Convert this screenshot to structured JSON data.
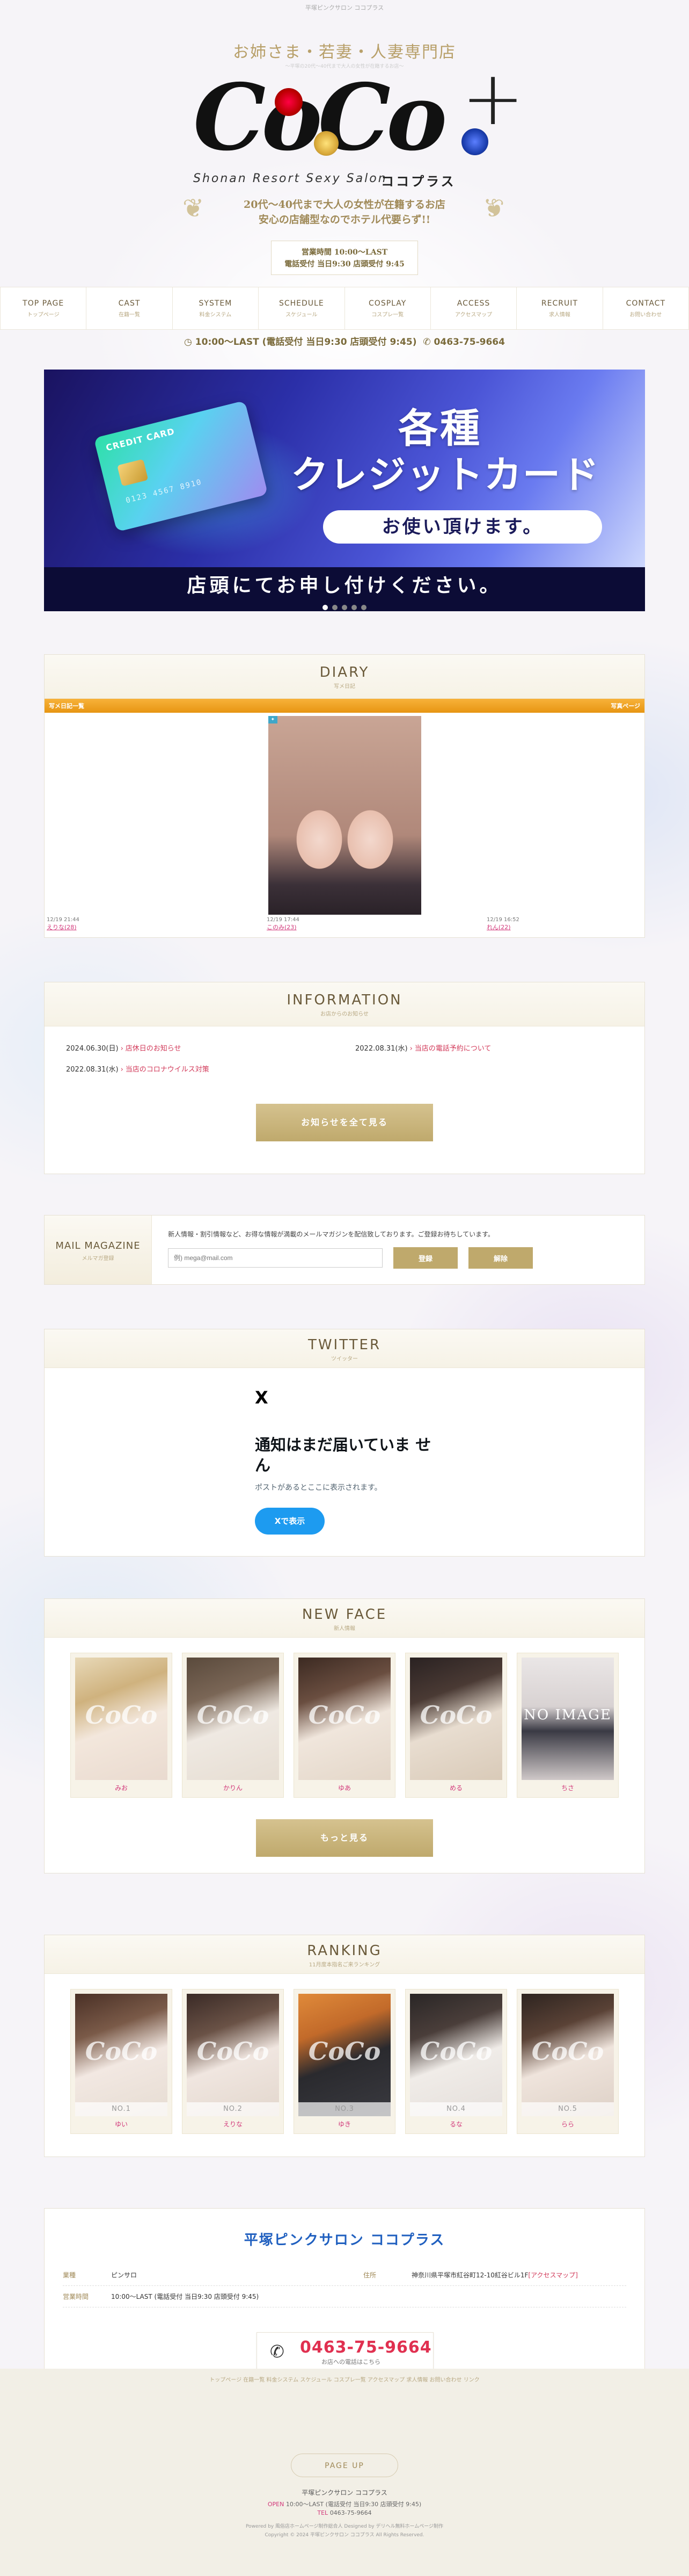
{
  "top_note": "平塚ピンクサロン ココプラス",
  "header": {
    "tagline": "お姉さま・若妻・人妻専門店",
    "tagline_sub": "～平塚の20代～40代まで大人の女性が在籍するお店～",
    "logo": "CoCo",
    "logo_plus": "+",
    "logo_sub": "Shonan Resort Sexy Salon",
    "logo_kana": "ココプラス",
    "catch1": "20代～40代まで大人の女性が在籍するお店",
    "catch2": "安心の店舗型なのでホテル代要らず!!",
    "hours_line1": "営業時間 10:00～LAST",
    "hours_line2": "電話受付 当日9:30  店頭受付 9:45"
  },
  "nav": [
    {
      "en": "TOP PAGE",
      "ja": "トップページ"
    },
    {
      "en": "CAST",
      "ja": "在籍一覧"
    },
    {
      "en": "SYSTEM",
      "ja": "料金システム"
    },
    {
      "en": "SCHEDULE",
      "ja": "スケジュール"
    },
    {
      "en": "COSPLAY",
      "ja": "コスプレ一覧"
    },
    {
      "en": "ACCESS",
      "ja": "アクセスマップ"
    },
    {
      "en": "RECRUIT",
      "ja": "求人情報"
    },
    {
      "en": "CONTACT",
      "ja": "お問い合わせ"
    }
  ],
  "infobar": {
    "hours": "10:00～LAST (電話受付 当日9:30 店頭受付 9:45)",
    "tel": "0463-75-9664"
  },
  "banner": {
    "card_label": "CREDIT CARD",
    "card_number": "0123 4567 8910",
    "title1": "各種",
    "title2": "クレジットカード",
    "pill": "お使い頂けます。",
    "bottom": "店頭にてお申し付けください。"
  },
  "diary": {
    "title": "DIARY",
    "sub": "写メ日記",
    "bar_left": "写メ日記一覧",
    "bar_right": "写真ページ",
    "items": [
      {
        "date": "12/19  21:44",
        "name": "えりな(28)"
      },
      {
        "date": "12/19  17:44",
        "name": "このみ(23)"
      },
      {
        "date": "12/19  16:52",
        "name": "れん(22)"
      }
    ]
  },
  "information": {
    "title": "INFORMATION",
    "sub": "お店からのお知らせ",
    "items": [
      {
        "date": "2024.06.30(日)",
        "text": "店休日のお知らせ"
      },
      {
        "date": "2022.08.31(水)",
        "text": "当店の電話予約について"
      },
      {
        "date": "2022.08.31(水)",
        "text": "当店のコロナウイルス対策"
      }
    ],
    "more": "お知らせを全て見る"
  },
  "mail": {
    "title": "MAIL MAGAZINE",
    "sub": "メルマガ登録",
    "desc": "新人情報・割引情報など、お得な情報が満載のメールマガジンを配信致しております。ご登録お待ちしています。",
    "placeholder": "例) mega@mail.com",
    "register": "登録",
    "unsubscribe": "解除"
  },
  "twitter": {
    "title": "TWITTER",
    "sub": "ツイッター",
    "x_icon": "X",
    "empty_title": "通知はまだ届いていま せん",
    "empty_text": "ポストがあるとここに表示されます。",
    "button": "Xで表示"
  },
  "newface": {
    "title": "NEW FACE",
    "sub": "新人情報",
    "items": [
      {
        "name": "みお"
      },
      {
        "name": "かりん"
      },
      {
        "name": "ゆあ"
      },
      {
        "name": "める"
      },
      {
        "name": "ちさ"
      }
    ],
    "no_image": "NO IMAGE",
    "more": "もっと見る"
  },
  "ranking": {
    "title": "RANKING",
    "sub": "11月度本指名ご来ランキング",
    "items": [
      {
        "rank": "NO.1",
        "name": "ゆい"
      },
      {
        "rank": "NO.2",
        "name": "えりな"
      },
      {
        "rank": "NO.3",
        "name": "ゆき"
      },
      {
        "rank": "NO.4",
        "name": "るな"
      },
      {
        "rank": "NO.5",
        "name": "らら"
      }
    ]
  },
  "shop": {
    "title": "平塚ピンクサロン ココプラス",
    "genre_label": "業種",
    "genre": "ピンサロ",
    "address_label": "住所",
    "address": "神奈川県平塚市紅谷町12-10紅谷ビル1F",
    "access_link": "[アクセスマップ]",
    "hours_label": "営業時間",
    "hours": "10:00～LAST (電話受付 当日9:30 店頭受付 9:45)",
    "tel": "0463-75-9664",
    "tel_caption": "お店への電話はこちら"
  },
  "footer": {
    "links": "トップページ  在籍一覧  料金システム  スケジュール  コスプレ一覧  アクセスマップ  求人情報  お問い合わせ  リンク",
    "pageup": "PAGE UP",
    "shop": "平塚ピンクサロン ココプラス",
    "open_label": "OPEN",
    "open": "10:00～LAST (電話受付 当日9:30 店頭受付 9:45)",
    "tel_label": "TEL",
    "tel": "0463-75-9664",
    "powered": "Powered by 風俗店ホームページ制作総合人  Designed by デリヘル無料ホームページ制作",
    "copyright": "Copyright © 2024 平塚ピンクサロン ココプラス All Rights Reserved."
  }
}
